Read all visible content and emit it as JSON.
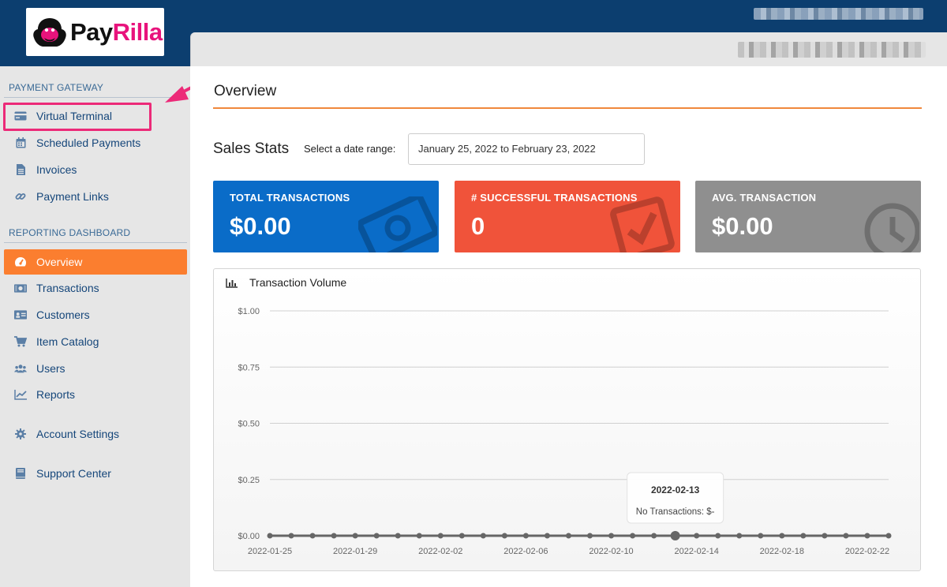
{
  "brand": {
    "name_part1": "Pay",
    "name_part2": "Rilla",
    "accent": "#e8137c"
  },
  "sidebar": {
    "sections": [
      {
        "title": "PAYMENT GATEWAY"
      },
      {
        "title": "REPORTING DASHBOARD"
      }
    ],
    "items": [
      {
        "label": "Virtual Terminal",
        "icon": "credit-card-icon"
      },
      {
        "label": "Scheduled Payments",
        "icon": "calendar-icon"
      },
      {
        "label": "Invoices",
        "icon": "file-icon"
      },
      {
        "label": "Payment Links",
        "icon": "link-icon"
      },
      {
        "label": "Overview",
        "icon": "dashboard-icon",
        "active": true
      },
      {
        "label": "Transactions",
        "icon": "money-icon"
      },
      {
        "label": "Customers",
        "icon": "id-card-icon"
      },
      {
        "label": "Item Catalog",
        "icon": "cart-icon"
      },
      {
        "label": "Users",
        "icon": "users-icon"
      },
      {
        "label": "Reports",
        "icon": "line-chart-icon"
      },
      {
        "label": "Account Settings",
        "icon": "gear-icon"
      },
      {
        "label": "Support Center",
        "icon": "book-icon"
      }
    ]
  },
  "main": {
    "title": "Overview",
    "sales_stats": {
      "title": "Sales Stats",
      "range_label": "Select a date range:",
      "range_value": "January 25, 2022 to February 23, 2022"
    },
    "cards": [
      {
        "label": "TOTAL TRANSACTIONS",
        "value": "$0.00",
        "color": "#0a6cc8",
        "icon": "money-bill-icon"
      },
      {
        "label": "# SUCCESSFUL TRANSACTIONS",
        "value": "0",
        "color": "#f0533a",
        "icon": "checkbox-icon"
      },
      {
        "label": "AVG. TRANSACTION",
        "value": "$0.00",
        "color": "#8f8f8f",
        "icon": "clock-icon"
      }
    ]
  },
  "chart_data": {
    "type": "line",
    "title": "Transaction Volume",
    "y_ticks": [
      "$1.00",
      "$0.75",
      "$0.50",
      "$0.25",
      "$0.00"
    ],
    "ylim": [
      0,
      1
    ],
    "x_tick_labels": [
      "2022-01-25",
      "2022-01-29",
      "2022-02-02",
      "2022-02-06",
      "2022-02-10",
      "2022-02-14",
      "2022-02-18",
      "2022-02-22"
    ],
    "x_start": "2022-01-25",
    "x_end": "2022-02-23",
    "values": [
      0,
      0,
      0,
      0,
      0,
      0,
      0,
      0,
      0,
      0,
      0,
      0,
      0,
      0,
      0,
      0,
      0,
      0,
      0,
      0,
      0,
      0,
      0,
      0,
      0,
      0,
      0,
      0,
      0,
      0
    ],
    "grid": true,
    "tooltip": {
      "date": "2022-02-13",
      "text": "No Transactions: $-"
    },
    "line_color": "#666666"
  }
}
